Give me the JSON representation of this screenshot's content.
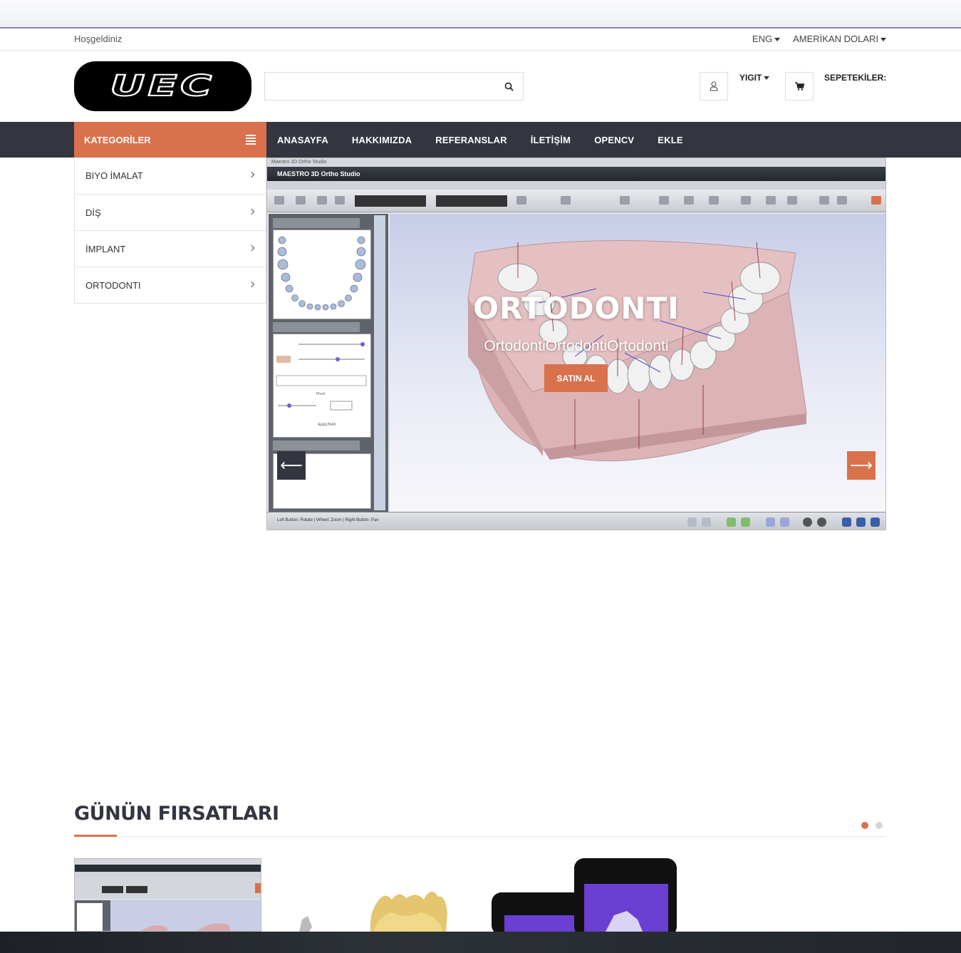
{
  "topbar": {
    "welcome": "Hoşgeldiniz",
    "language": "ENG",
    "currency": "AMERİKAN DOLARI"
  },
  "header": {
    "logo_text": "UEC",
    "search_placeholder": "",
    "user_name": "YIGIT",
    "cart_label": "SEPETEKİLER:"
  },
  "categories": {
    "title": "KATEGORİLER",
    "items": [
      {
        "label": "BIYO İMALAT"
      },
      {
        "label": "DİŞ"
      },
      {
        "label": "İMPLANT"
      },
      {
        "label": "ORTODONTI"
      }
    ]
  },
  "nav": {
    "items": [
      "ANASAYFA",
      "HAKKIMIZDA",
      "REFERANSLAR",
      "İLETİŞİM",
      "OPENCV",
      "EKLE"
    ]
  },
  "slider": {
    "app_title": "MAESTRO 3D Ortho Studio",
    "window_title": "Maestro 3D Ortho Studio",
    "status_text": "Left Button: Rotate | Wheel: Zoom | Right Button: Pan",
    "title": "ORTODONTI",
    "subtitle": "OrtodontiOrtodontiOrtodonti",
    "button": "SATIN AL",
    "prev_arrow": "⟵",
    "next_arrow": "⟶"
  },
  "deals": {
    "title": "GÜNÜN FIRSATLARI"
  },
  "icons": {
    "search": "search-icon",
    "user": "user-icon",
    "cart": "cart-icon",
    "menu": "hamburger-icon"
  },
  "colors": {
    "accent": "#d9714c",
    "nav_bg": "#33353f"
  }
}
